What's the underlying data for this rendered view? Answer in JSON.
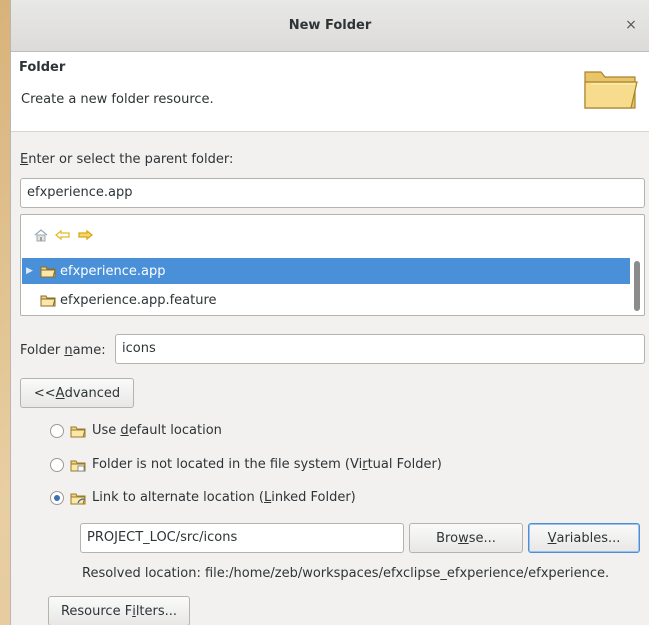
{
  "window": {
    "title": "New Folder",
    "close_glyph": "×"
  },
  "banner": {
    "title": "Folder",
    "description": "Create a new folder resource."
  },
  "parent": {
    "label_first": "E",
    "label_rest": "nter or select the parent folder:",
    "value": "efxperience.app"
  },
  "tree": {
    "items": [
      {
        "label": "efxperience.app",
        "selected": true
      },
      {
        "label": "efxperience.app.feature",
        "selected": false
      }
    ]
  },
  "folder_name": {
    "label_pre": "Folder ",
    "label_u": "n",
    "label_post": "ame:",
    "value": "icons"
  },
  "advanced_button": {
    "pre": "<< ",
    "u": "A",
    "post": "dvanced"
  },
  "options": [
    {
      "pre": "Use ",
      "u": "d",
      "post": "efault location",
      "checked": false
    },
    {
      "pre": "Folder is not located in the file system (Vi",
      "u": "r",
      "post": "tual Folder)",
      "checked": false
    },
    {
      "pre": "Link to alternate location (",
      "u": "L",
      "post": "inked Folder)",
      "checked": true
    }
  ],
  "link": {
    "value": "PROJECT_LOC/src/icons",
    "browse": {
      "pre": "Bro",
      "u": "w",
      "post": "se..."
    },
    "variables": {
      "pre": "",
      "u": "V",
      "post": "ariables..."
    },
    "resolved": "Resolved location: file:/home/zeb/workspaces/efxclipse_efxperience/efxperience."
  },
  "resource_filters": {
    "pre": "Resource F",
    "u": "i",
    "post": "lters..."
  },
  "colors": {
    "selection": "#4a90d9",
    "folder": "#f0c24b",
    "nav_arrow": "#e4b92a"
  }
}
